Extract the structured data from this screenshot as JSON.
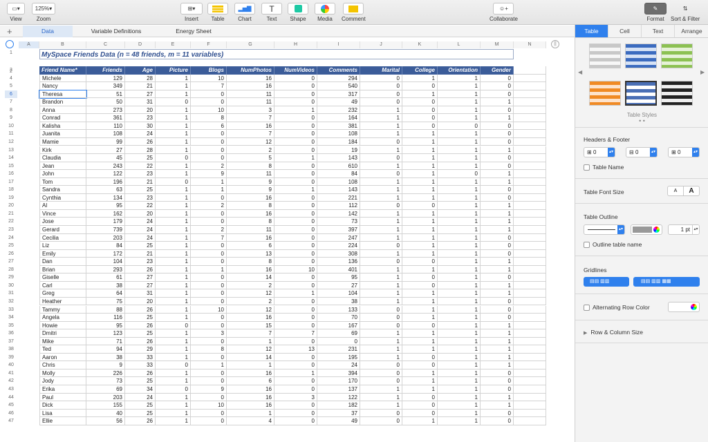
{
  "toolbar": {
    "view": "View",
    "zoom_value": "125%",
    "zoom": "Zoom",
    "insert": "Insert",
    "table": "Table",
    "chart": "Chart",
    "text": "Text",
    "shape": "Shape",
    "media": "Media",
    "comment": "Comment",
    "collaborate": "Collaborate",
    "format": "Format",
    "sort_filter": "Sort & Filter"
  },
  "sheet_tabs": [
    "Data",
    "Variable Definitions",
    "Energy Sheet"
  ],
  "columns": [
    "A",
    "B",
    "C",
    "D",
    "E",
    "F",
    "G",
    "H",
    "I",
    "J",
    "K",
    "L",
    "M",
    "N"
  ],
  "table": {
    "title": "MySpace Friends Data (n = 48 friends, m = 11 variables)",
    "headers": [
      "Friend Name*",
      "Friends",
      "Age",
      "Picture",
      "Blogs",
      "NumPhotos",
      "NumVideos",
      "Comments",
      "Marital",
      "College",
      "Orientation",
      "Gender"
    ],
    "rows": [
      [
        "Michele",
        129,
        28,
        1,
        10,
        16,
        0,
        294,
        0,
        1,
        1,
        0
      ],
      [
        "Nancy",
        349,
        21,
        1,
        7,
        16,
        0,
        540,
        0,
        0,
        1,
        0
      ],
      [
        "Theresa",
        51,
        27,
        1,
        0,
        11,
        0,
        317,
        0,
        1,
        1,
        0
      ],
      [
        "Brandon",
        50,
        31,
        0,
        0,
        11,
        0,
        49,
        0,
        0,
        1,
        1
      ],
      [
        "Anna",
        273,
        20,
        1,
        10,
        3,
        1,
        232,
        1,
        0,
        1,
        0
      ],
      [
        "Conrad",
        361,
        23,
        1,
        8,
        7,
        0,
        164,
        1,
        0,
        1,
        1
      ],
      [
        "Kalisha",
        110,
        30,
        1,
        6,
        16,
        0,
        381,
        1,
        0,
        0,
        0
      ],
      [
        "Juanita",
        108,
        24,
        1,
        0,
        7,
        0,
        108,
        1,
        1,
        1,
        0
      ],
      [
        "Mamie",
        99,
        26,
        1,
        0,
        12,
        0,
        184,
        0,
        1,
        1,
        0
      ],
      [
        "Kirk",
        27,
        28,
        1,
        0,
        2,
        0,
        19,
        1,
        1,
        1,
        1
      ],
      [
        "Claudia",
        45,
        25,
        0,
        0,
        5,
        1,
        143,
        0,
        1,
        1,
        0
      ],
      [
        "Jean",
        243,
        22,
        1,
        2,
        8,
        0,
        610,
        1,
        1,
        1,
        0
      ],
      [
        "John",
        122,
        23,
        1,
        9,
        11,
        0,
        84,
        0,
        1,
        0,
        1
      ],
      [
        "Tom",
        196,
        21,
        0,
        1,
        9,
        0,
        108,
        1,
        1,
        1,
        1
      ],
      [
        "Sandra",
        63,
        25,
        1,
        1,
        9,
        1,
        143,
        1,
        1,
        1,
        0
      ],
      [
        "Cynthia",
        134,
        23,
        1,
        0,
        16,
        0,
        221,
        1,
        1,
        1,
        0
      ],
      [
        "Al",
        95,
        22,
        1,
        2,
        8,
        0,
        112,
        0,
        0,
        1,
        1
      ],
      [
        "Vince",
        162,
        20,
        1,
        0,
        16,
        0,
        142,
        1,
        1,
        1,
        1
      ],
      [
        "Jose",
        179,
        24,
        1,
        0,
        8,
        0,
        73,
        1,
        1,
        1,
        1
      ],
      [
        "Gerard",
        739,
        24,
        1,
        2,
        11,
        0,
        397,
        1,
        1,
        1,
        1
      ],
      [
        "Cecilia",
        203,
        24,
        1,
        7,
        16,
        0,
        247,
        1,
        1,
        1,
        0
      ],
      [
        "Liz",
        84,
        25,
        1,
        0,
        6,
        0,
        224,
        0,
        1,
        1,
        0
      ],
      [
        "Emily",
        172,
        21,
        1,
        0,
        13,
        0,
        308,
        1,
        1,
        1,
        0
      ],
      [
        "Dan",
        104,
        23,
        1,
        0,
        8,
        0,
        136,
        0,
        0,
        1,
        1
      ],
      [
        "Brian",
        293,
        26,
        1,
        1,
        16,
        10,
        401,
        1,
        1,
        1,
        1
      ],
      [
        "Giselle",
        61,
        27,
        1,
        0,
        14,
        0,
        95,
        1,
        0,
        1,
        0
      ],
      [
        "Carl",
        38,
        27,
        1,
        0,
        2,
        0,
        27,
        1,
        0,
        1,
        1
      ],
      [
        "Greg",
        64,
        31,
        1,
        0,
        12,
        1,
        104,
        1,
        1,
        1,
        1
      ],
      [
        "Heather",
        75,
        20,
        1,
        0,
        2,
        0,
        38,
        1,
        1,
        1,
        0
      ],
      [
        "Tammy",
        88,
        26,
        1,
        10,
        12,
        0,
        133,
        0,
        1,
        1,
        0
      ],
      [
        "Angela",
        116,
        25,
        1,
        0,
        16,
        0,
        70,
        0,
        1,
        1,
        0
      ],
      [
        "Howie",
        95,
        26,
        0,
        0,
        15,
        0,
        167,
        0,
        0,
        1,
        1
      ],
      [
        "Dmitri",
        123,
        25,
        1,
        3,
        7,
        7,
        69,
        1,
        1,
        1,
        1
      ],
      [
        "Mike",
        71,
        26,
        1,
        0,
        1,
        0,
        0,
        1,
        1,
        1,
        1
      ],
      [
        "Ted",
        94,
        29,
        1,
        8,
        12,
        13,
        231,
        1,
        1,
        1,
        1
      ],
      [
        "Aaron",
        38,
        33,
        1,
        0,
        14,
        0,
        195,
        1,
        0,
        1,
        1
      ],
      [
        "Chris",
        9,
        33,
        0,
        1,
        1,
        0,
        24,
        0,
        0,
        1,
        1
      ],
      [
        "Molly",
        226,
        26,
        1,
        0,
        16,
        1,
        394,
        0,
        1,
        1,
        0
      ],
      [
        "Jody",
        73,
        25,
        1,
        0,
        6,
        0,
        170,
        0,
        1,
        1,
        0
      ],
      [
        "Erika",
        69,
        34,
        0,
        9,
        16,
        0,
        137,
        1,
        1,
        1,
        0
      ],
      [
        "Paul",
        203,
        24,
        1,
        0,
        16,
        3,
        122,
        1,
        0,
        1,
        1
      ],
      [
        "Dick",
        155,
        25,
        1,
        10,
        16,
        0,
        182,
        1,
        0,
        1,
        1
      ],
      [
        "Lisa",
        40,
        25,
        1,
        0,
        1,
        0,
        37,
        0,
        0,
        1,
        0
      ],
      [
        "Ellie",
        56,
        26,
        1,
        0,
        4,
        0,
        49,
        0,
        1,
        1,
        0
      ]
    ]
  },
  "inspector": {
    "tabs": [
      "Table",
      "Cell",
      "Text",
      "Arrange"
    ],
    "table_styles": "Table Styles",
    "headers_footer": "Headers & Footer",
    "header_rows": "0",
    "header_cols": "0",
    "footer_rows": "0",
    "table_name": "Table Name",
    "table_font_size": "Table Font Size",
    "font_small": "A",
    "font_large": "A",
    "table_outline": "Table Outline",
    "outline_width": "1 pt",
    "outline_table_name": "Outline table name",
    "gridlines": "Gridlines",
    "alternating_row_color": "Alternating Row Color",
    "row_column_size": "Row & Column Size"
  }
}
